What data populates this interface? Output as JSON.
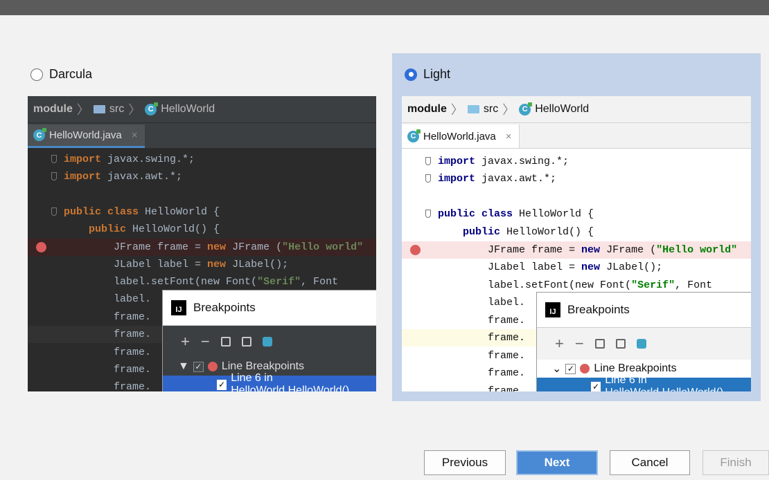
{
  "themes": {
    "darcula": {
      "label": "Darcula",
      "selected": false
    },
    "light": {
      "label": "Light",
      "selected": true
    }
  },
  "preview": {
    "breadcrumb": {
      "module": "module",
      "sep": "〉",
      "folder": "src",
      "file": "HelloWorld",
      "file_icon": "C"
    },
    "tab_label": "HelloWorld.java",
    "tab_close": "×",
    "code_lines": [
      {
        "kw": "import",
        "rest": " javax.swing.*;"
      },
      {
        "kw": "import",
        "rest": " javax.awt.*;"
      },
      {
        "kw": "public class",
        "rest": " HelloWorld {"
      },
      {
        "indent": "    ",
        "kw": "public",
        "rest": " HelloWorld() {"
      },
      {
        "indent": "        ",
        "pre": "JFrame frame = ",
        "kw": "new",
        "mid": " JFrame (",
        "str": "\"Hello world\""
      },
      {
        "indent": "        ",
        "pre": "JLabel label = ",
        "kw": "new",
        "mid": " JLabel();"
      },
      {
        "indent": "        ",
        "pre": "label.setFont(new Font(",
        "str": "\"Serif\"",
        "mid": ", Font"
      },
      {
        "text": "        label."
      },
      {
        "text": "        frame."
      },
      {
        "text": "        frame."
      },
      {
        "text": "        frame."
      },
      {
        "text": "        frame."
      },
      {
        "text": "        frame."
      }
    ],
    "dialog": {
      "title": "Breakpoints",
      "app_icon": "IJ",
      "tool_add": "+",
      "tool_remove": "−",
      "group_label": "Line Breakpoints",
      "group_arrow_dark": "▼",
      "group_arrow_light": "⌄",
      "check": "✓",
      "item_label": "Line 6 in HelloWorld.HelloWorld()"
    }
  },
  "buttons": {
    "previous": "Previous",
    "next": "Next",
    "cancel": "Cancel",
    "finish": "Finish"
  },
  "colors": {
    "accent": "#2f6ed8",
    "selection_panel": "#c4d3ea",
    "breakpoint": "#db5c5c",
    "dark_bg": "#2b2b2b"
  }
}
